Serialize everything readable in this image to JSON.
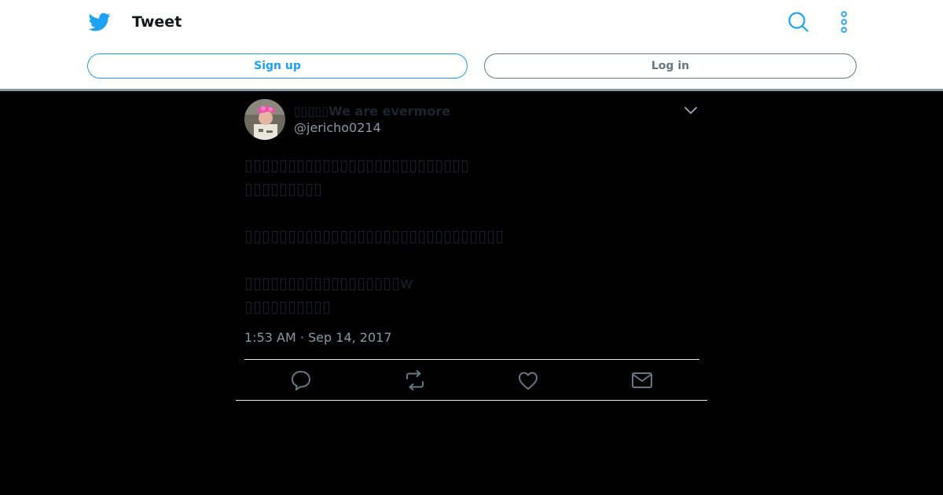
{
  "header": {
    "title": "Tweet",
    "signup_label": "Sign up",
    "login_label": "Log in"
  },
  "tweet": {
    "display_name": "▯▯▯▯▯We are evermore",
    "handle": "@jericho0214",
    "lines": [
      "▯▯▯▯▯▯▯▯▯▯▯▯▯▯▯▯▯▯▯▯▯▯▯▯▯▯",
      "▯▯▯▯▯▯▯▯▯",
      "",
      "▯▯▯▯▯▯▯▯▯▯▯▯▯▯▯▯▯▯▯▯▯▯▯▯▯▯▯▯▯▯",
      "",
      "▯▯▯▯▯▯▯▯▯▯▯▯▯▯▯▯▯▯w",
      "▯▯▯▯▯▯▯▯▯▯"
    ],
    "timestamp": "1:53 AM · Sep 14, 2017"
  },
  "icons": {
    "logo": "twitter-bird-icon",
    "search": "search-icon",
    "more": "more-vertical-icon",
    "caret": "chevron-down-icon",
    "reply": "reply-icon",
    "retweet": "retweet-icon",
    "like": "heart-icon",
    "share": "mail-icon"
  },
  "colors": {
    "brand": "#1da1f2",
    "muted": "#657786",
    "secondary": "#8899a6",
    "background": "#000000"
  }
}
